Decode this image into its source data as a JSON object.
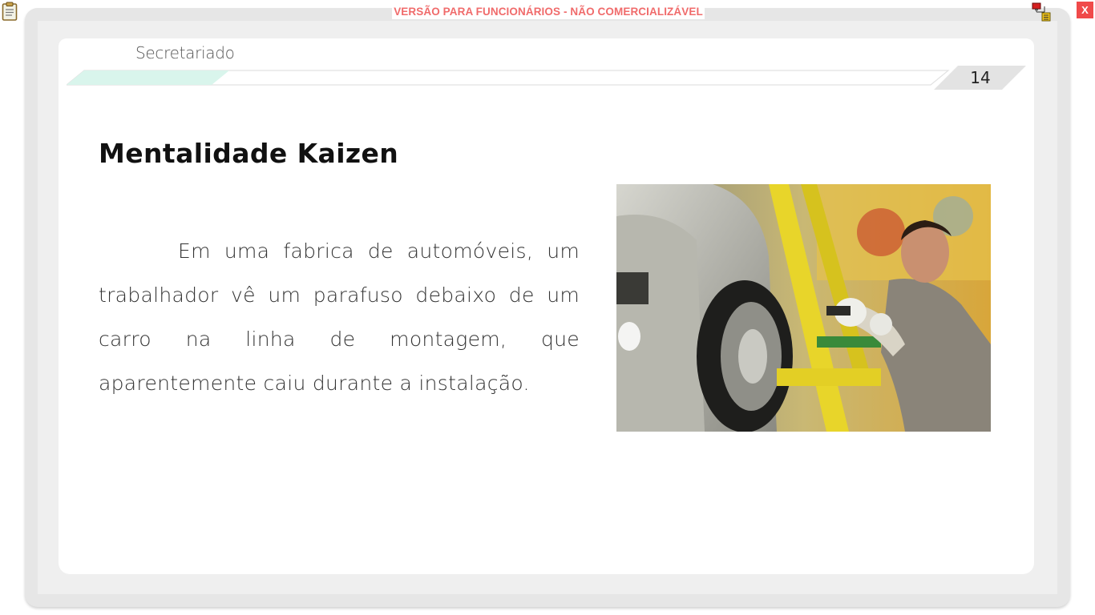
{
  "toolbar": {
    "clipboard_icon": "clipboard-icon",
    "watermark": "VERSÃO PARA FUNCIONÁRIOS - NÃO COMERCIALIZÁVEL",
    "network_icon": "network-status-icon",
    "close_label": "X"
  },
  "slide": {
    "header_label": "Secretariado",
    "page_number": "14",
    "title": "Mentalidade Kaizen",
    "body": "Em uma fabrica de automóveis, um trabalhador vê um parafuso debaixo de um carro na linha de montagem, que aparentemente caiu durante a instalação.",
    "photo_label": "car-factory-worker-photo"
  },
  "colors": {
    "watermark": "#f06b6b",
    "close_button": "#f04a4a",
    "header_accent": "#d9f5ec",
    "frame": "#e6e6e6"
  }
}
